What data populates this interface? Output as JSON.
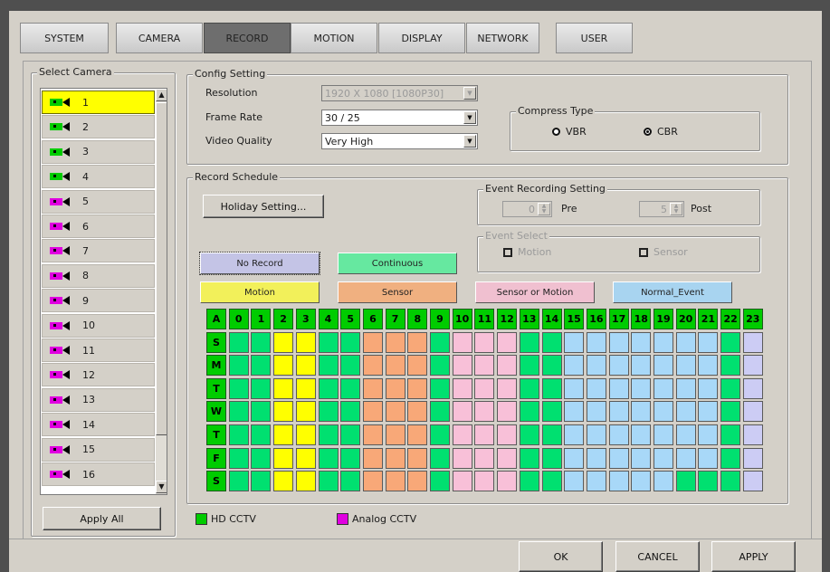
{
  "tabs": [
    {
      "label": "SYSTEM",
      "active": false
    },
    {
      "label": "CAMERA",
      "active": false
    },
    {
      "label": "RECORD",
      "active": true
    },
    {
      "label": "MOTION",
      "active": false
    },
    {
      "label": "DISPLAY",
      "active": false
    },
    {
      "label": "NETWORK",
      "active": false
    },
    {
      "label": "USER",
      "active": false
    }
  ],
  "select_camera": {
    "title": "Select Camera",
    "cameras": [
      {
        "num": "1",
        "type": "hd",
        "selected": true
      },
      {
        "num": "2",
        "type": "hd"
      },
      {
        "num": "3",
        "type": "hd"
      },
      {
        "num": "4",
        "type": "hd"
      },
      {
        "num": "5",
        "type": "analog"
      },
      {
        "num": "6",
        "type": "analog"
      },
      {
        "num": "7",
        "type": "analog"
      },
      {
        "num": "8",
        "type": "analog"
      },
      {
        "num": "9",
        "type": "analog"
      },
      {
        "num": "10",
        "type": "analog"
      },
      {
        "num": "11",
        "type": "analog"
      },
      {
        "num": "12",
        "type": "analog"
      },
      {
        "num": "13",
        "type": "analog"
      },
      {
        "num": "14",
        "type": "analog"
      },
      {
        "num": "15",
        "type": "analog"
      },
      {
        "num": "16",
        "type": "analog"
      }
    ],
    "apply_all": "Apply All"
  },
  "config": {
    "title": "Config Setting",
    "resolution_label": "Resolution",
    "resolution_value": "1920 X 1080 [1080P30]",
    "frame_rate_label": "Frame Rate",
    "frame_rate_value": "30 / 25",
    "quality_label": "Video Quality",
    "quality_value": "Very High",
    "compress_title": "Compress Type",
    "vbr": "VBR",
    "cbr": "CBR",
    "compress_selected": "CBR"
  },
  "schedule": {
    "title": "Record Schedule",
    "holiday_button": "Holiday Setting...",
    "event_title": "Event Recording Setting",
    "pre_value": "0",
    "pre_label": "Pre",
    "post_value": "5",
    "post_label": "Post",
    "event_select_title": "Event Select",
    "motion_label": "Motion",
    "sensor_label": "Sensor",
    "modes": [
      {
        "key": "no_record",
        "label": "No Record",
        "color": "#c4c4e6"
      },
      {
        "key": "continuous",
        "label": "Continuous",
        "color": "#66e8a0"
      },
      {
        "key": "motion",
        "label": "Motion",
        "color": "#f2f05a"
      },
      {
        "key": "sensor",
        "label": "Sensor",
        "color": "#f0b080"
      },
      {
        "key": "sensor_or_motion",
        "label": "Sensor or Motion",
        "color": "#f0c0d0"
      },
      {
        "key": "normal_event",
        "label": "Normal_Event",
        "color": "#a8d4f0"
      }
    ],
    "hours": [
      "0",
      "1",
      "2",
      "3",
      "4",
      "5",
      "6",
      "7",
      "8",
      "9",
      "10",
      "11",
      "12",
      "13",
      "14",
      "15",
      "16",
      "17",
      "18",
      "19",
      "20",
      "21",
      "22",
      "23"
    ],
    "all_label": "A",
    "days": [
      "S",
      "M",
      "T",
      "W",
      "T",
      "F",
      "S"
    ],
    "palette": {
      "C": "#00e070",
      "M": "#ffff00",
      "S": "#f8a878",
      "X": "#f8c0d8",
      "N": "#a8d8f8",
      "R": "#ccccf4"
    },
    "rows": [
      "CCMMCCSSSCXXXCCNNNNNNNCR",
      "CCMMCCSSSCXXXCCNNNNNNNCR",
      "CCMMCCSSSCXXXCCNNNNNNNCR",
      "CCMMCCSSSCXXXCCNNNNNNNCR",
      "CCMMCCSSSCXXXCCNNNNNNNCR",
      "CCMMCCSSSCXXXCCNNNNNNNCR",
      "CCMMCCSSSCXXXCCNNNNNCCCR"
    ]
  },
  "legend": {
    "hd_label": "HD CCTV",
    "hd_color": "#00cc00",
    "analog_label": "Analog CCTV",
    "analog_color": "#e000e0"
  },
  "footer": {
    "ok": "OK",
    "cancel": "CANCEL",
    "apply": "APPLY"
  }
}
